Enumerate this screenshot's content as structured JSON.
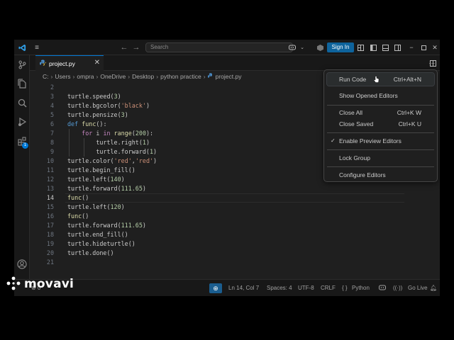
{
  "titlebar": {
    "search_placeholder": "Search",
    "signin_label": "Sign In"
  },
  "activity": {
    "extensions_badge": "1"
  },
  "tab": {
    "filename": "project.py",
    "close_glyph": "✕"
  },
  "breadcrumb": {
    "parts": [
      "C:",
      "Users",
      "ompra",
      "OneDrive",
      "Desktop",
      "python practice",
      "project.py"
    ]
  },
  "editor": {
    "current_line": 14,
    "lines": [
      {
        "n": "2",
        "text": ""
      },
      {
        "n": "3",
        "text": "turtle.speed(3)"
      },
      {
        "n": "4",
        "text": "turtle.bgcolor('black')"
      },
      {
        "n": "5",
        "text": "turtle.pensize(3)"
      },
      {
        "n": "6",
        "text": "def func():"
      },
      {
        "n": "7",
        "text": "    for i in range(200):"
      },
      {
        "n": "8",
        "text": "        turtle.right(1)"
      },
      {
        "n": "9",
        "text": "        turtle.forward(1)"
      },
      {
        "n": "10",
        "text": "turtle.color('red','red')"
      },
      {
        "n": "11",
        "text": "turtle.begin_fill()"
      },
      {
        "n": "12",
        "text": "turtle.left(140)"
      },
      {
        "n": "13",
        "text": "turtle.forward(111.65)"
      },
      {
        "n": "14",
        "text": "func()"
      },
      {
        "n": "15",
        "text": "turtle.left(120)"
      },
      {
        "n": "16",
        "text": "func()"
      },
      {
        "n": "17",
        "text": "turtle.forward(111.65)"
      },
      {
        "n": "18",
        "text": "turtle.end_fill()"
      },
      {
        "n": "19",
        "text": "turtle.hideturtle()"
      },
      {
        "n": "20",
        "text": "turtle.done()"
      },
      {
        "n": "21",
        "text": ""
      }
    ]
  },
  "menu": {
    "run_code": {
      "label": "Run Code",
      "shortcut": "Ctrl+Alt+N"
    },
    "show_opened": {
      "label": "Show Opened Editors"
    },
    "close_all": {
      "label": "Close All",
      "shortcut": "Ctrl+K W"
    },
    "close_saved": {
      "label": "Close Saved",
      "shortcut": "Ctrl+K U"
    },
    "enable_preview": {
      "label": "Enable Preview Editors",
      "checked": true
    },
    "lock_group": {
      "label": "Lock Group"
    },
    "configure": {
      "label": "Configure Editors"
    }
  },
  "statusbar": {
    "position": "Ln 14, Col 7",
    "spaces": "Spaces: 4",
    "encoding": "UTF-8",
    "eol": "CRLF",
    "language": "Python",
    "golive": "Go Live"
  },
  "watermark": {
    "text": "movavi"
  },
  "colors": {
    "accent": "#0078d4",
    "signin_bg": "#0e639c",
    "keyword": "#c586c0",
    "string": "#ce9178",
    "number": "#b5cea8",
    "function": "#dcdcaa"
  },
  "icons": [
    "vscode-logo-icon",
    "menu-icon",
    "back-arrow-icon",
    "forward-arrow-icon",
    "copilot-icon",
    "account-toggle-icon",
    "layout-icon",
    "minimize-icon",
    "maximize-icon",
    "close-icon",
    "source-control-icon",
    "explorer-icon",
    "search-icon",
    "run-debug-icon",
    "extensions-icon",
    "account-icon",
    "settings-gear-icon",
    "python-file-icon",
    "split-editor-icon",
    "more-actions-icon",
    "check-icon",
    "cursor-icon"
  ]
}
